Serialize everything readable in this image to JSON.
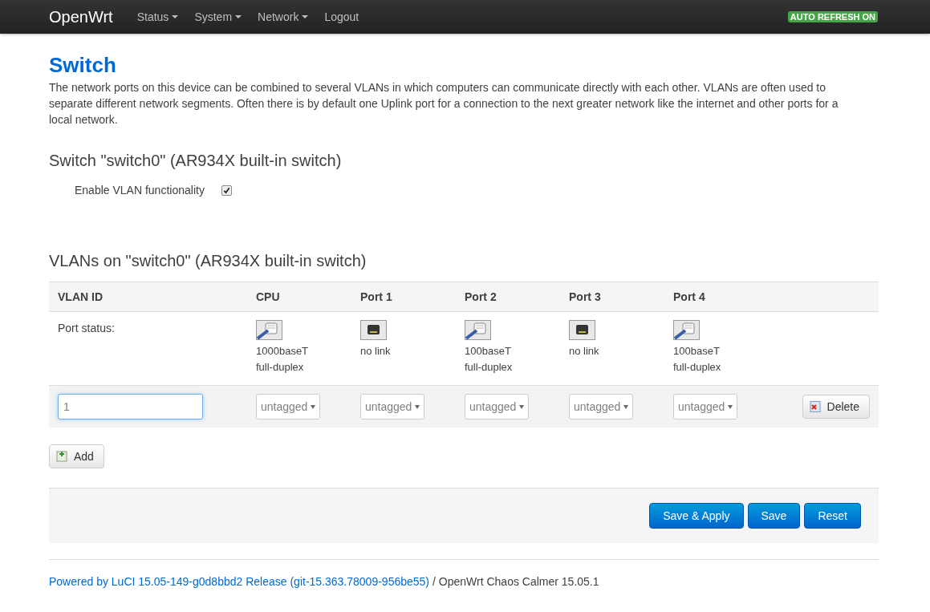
{
  "navbar": {
    "brand": "OpenWrt",
    "menu": [
      {
        "label": "Status",
        "dropdown": true
      },
      {
        "label": "System",
        "dropdown": true
      },
      {
        "label": "Network",
        "dropdown": true
      },
      {
        "label": "Logout",
        "dropdown": false
      }
    ],
    "badge": "AUTO REFRESH ON"
  },
  "page": {
    "title": "Switch",
    "description": "The network ports on this device can be combined to several VLANs in which computers can communicate directly with each other. VLANs are often used to separate different network segments. Often there is by default one Uplink port for a connection to the next greater network like the internet and other ports for a local network."
  },
  "switch_section": {
    "title": "Switch \"switch0\" (AR934X built-in switch)",
    "option": {
      "label": "Enable VLAN functionality",
      "checked": true
    }
  },
  "vlan_section": {
    "title": "VLANs on \"switch0\" (AR934X built-in switch)",
    "columns": [
      "VLAN ID",
      "CPU",
      "Port 1",
      "Port 2",
      "Port 3",
      "Port 4"
    ],
    "status_label": "Port status:",
    "ports": [
      {
        "kind": "link",
        "speed": "1000baseT",
        "duplex": "full-duplex"
      },
      {
        "kind": "nolink",
        "speed": "no link"
      },
      {
        "kind": "link",
        "speed": "100baseT",
        "duplex": "full-duplex"
      },
      {
        "kind": "nolink",
        "speed": "no link"
      },
      {
        "kind": "link",
        "speed": "100baseT",
        "duplex": "full-duplex"
      }
    ],
    "rows": [
      {
        "vlan_id": "1",
        "ports": [
          "untagged",
          "untagged",
          "untagged",
          "untagged",
          "untagged"
        ],
        "delete": "Delete"
      }
    ],
    "add": "Add"
  },
  "actions": [
    "Save & Apply",
    "Save",
    "Reset"
  ],
  "footer": {
    "link": "Powered by LuCI 15.05-149-g0d8bbd2 Release (git-15.363.78009-956be55)",
    "text": "/ OpenWrt Chaos Calmer 15.05.1"
  }
}
